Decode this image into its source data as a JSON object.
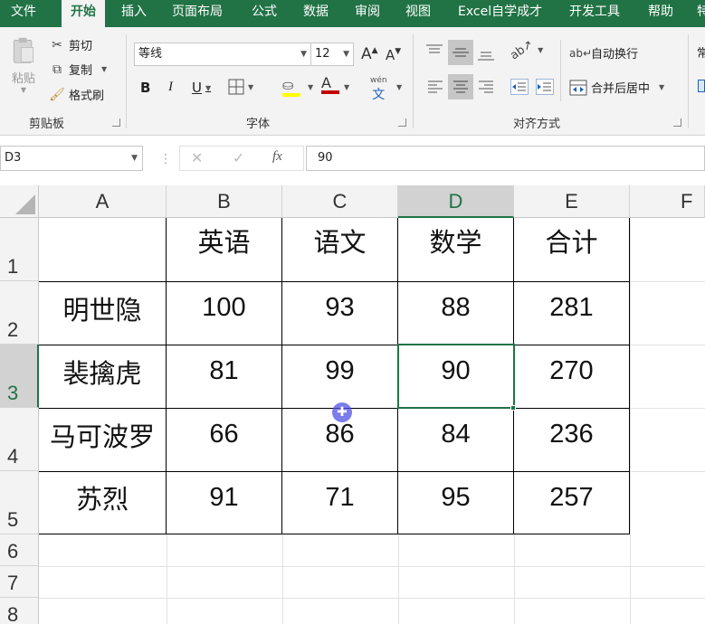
{
  "ribbon_tabs": [
    "文件",
    "开始",
    "插入",
    "页面布局",
    "公式",
    "数据",
    "审阅",
    "视图",
    "Excel自学成才",
    "开发工具",
    "帮助",
    "特"
  ],
  "active_tab": "开始",
  "clipboard": {
    "paste": "粘贴",
    "cut": "剪切",
    "copy": "复制",
    "format_painter": "格式刷",
    "group_label": "剪贴板"
  },
  "font": {
    "name": "等线",
    "size": "12",
    "group_label": "字体",
    "bold": "B",
    "italic": "I",
    "underline": "U",
    "grow": "A",
    "shrink": "A",
    "font_color": "A",
    "phonetic": "wén"
  },
  "alignment": {
    "wrap_text": "自动换行",
    "merge_center": "合并后居中",
    "group_label": "对齐方式"
  },
  "partial_group": "常",
  "formula_bar": {
    "name_box": "D3",
    "cancel": "✕",
    "enter": "✓",
    "fx": "fx",
    "value": "90"
  },
  "columns": [
    "A",
    "B",
    "C",
    "D",
    "E",
    "F"
  ],
  "rows": [
    "1",
    "2",
    "3",
    "4",
    "5",
    "6",
    "7",
    "8"
  ],
  "table": {
    "headers": [
      "",
      "英语",
      "语文",
      "数学",
      "合计"
    ],
    "data": [
      [
        "明世隐",
        "100",
        "93",
        "88",
        "281"
      ],
      [
        "裴擒虎",
        "81",
        "99",
        "90",
        "270"
      ],
      [
        "马可波罗",
        "66",
        "86",
        "84",
        "236"
      ],
      [
        "苏烈",
        "91",
        "71",
        "95",
        "257"
      ]
    ]
  },
  "selected_cell": "D3",
  "colors": {
    "brand": "#217346",
    "cursor": "#5050e6"
  }
}
